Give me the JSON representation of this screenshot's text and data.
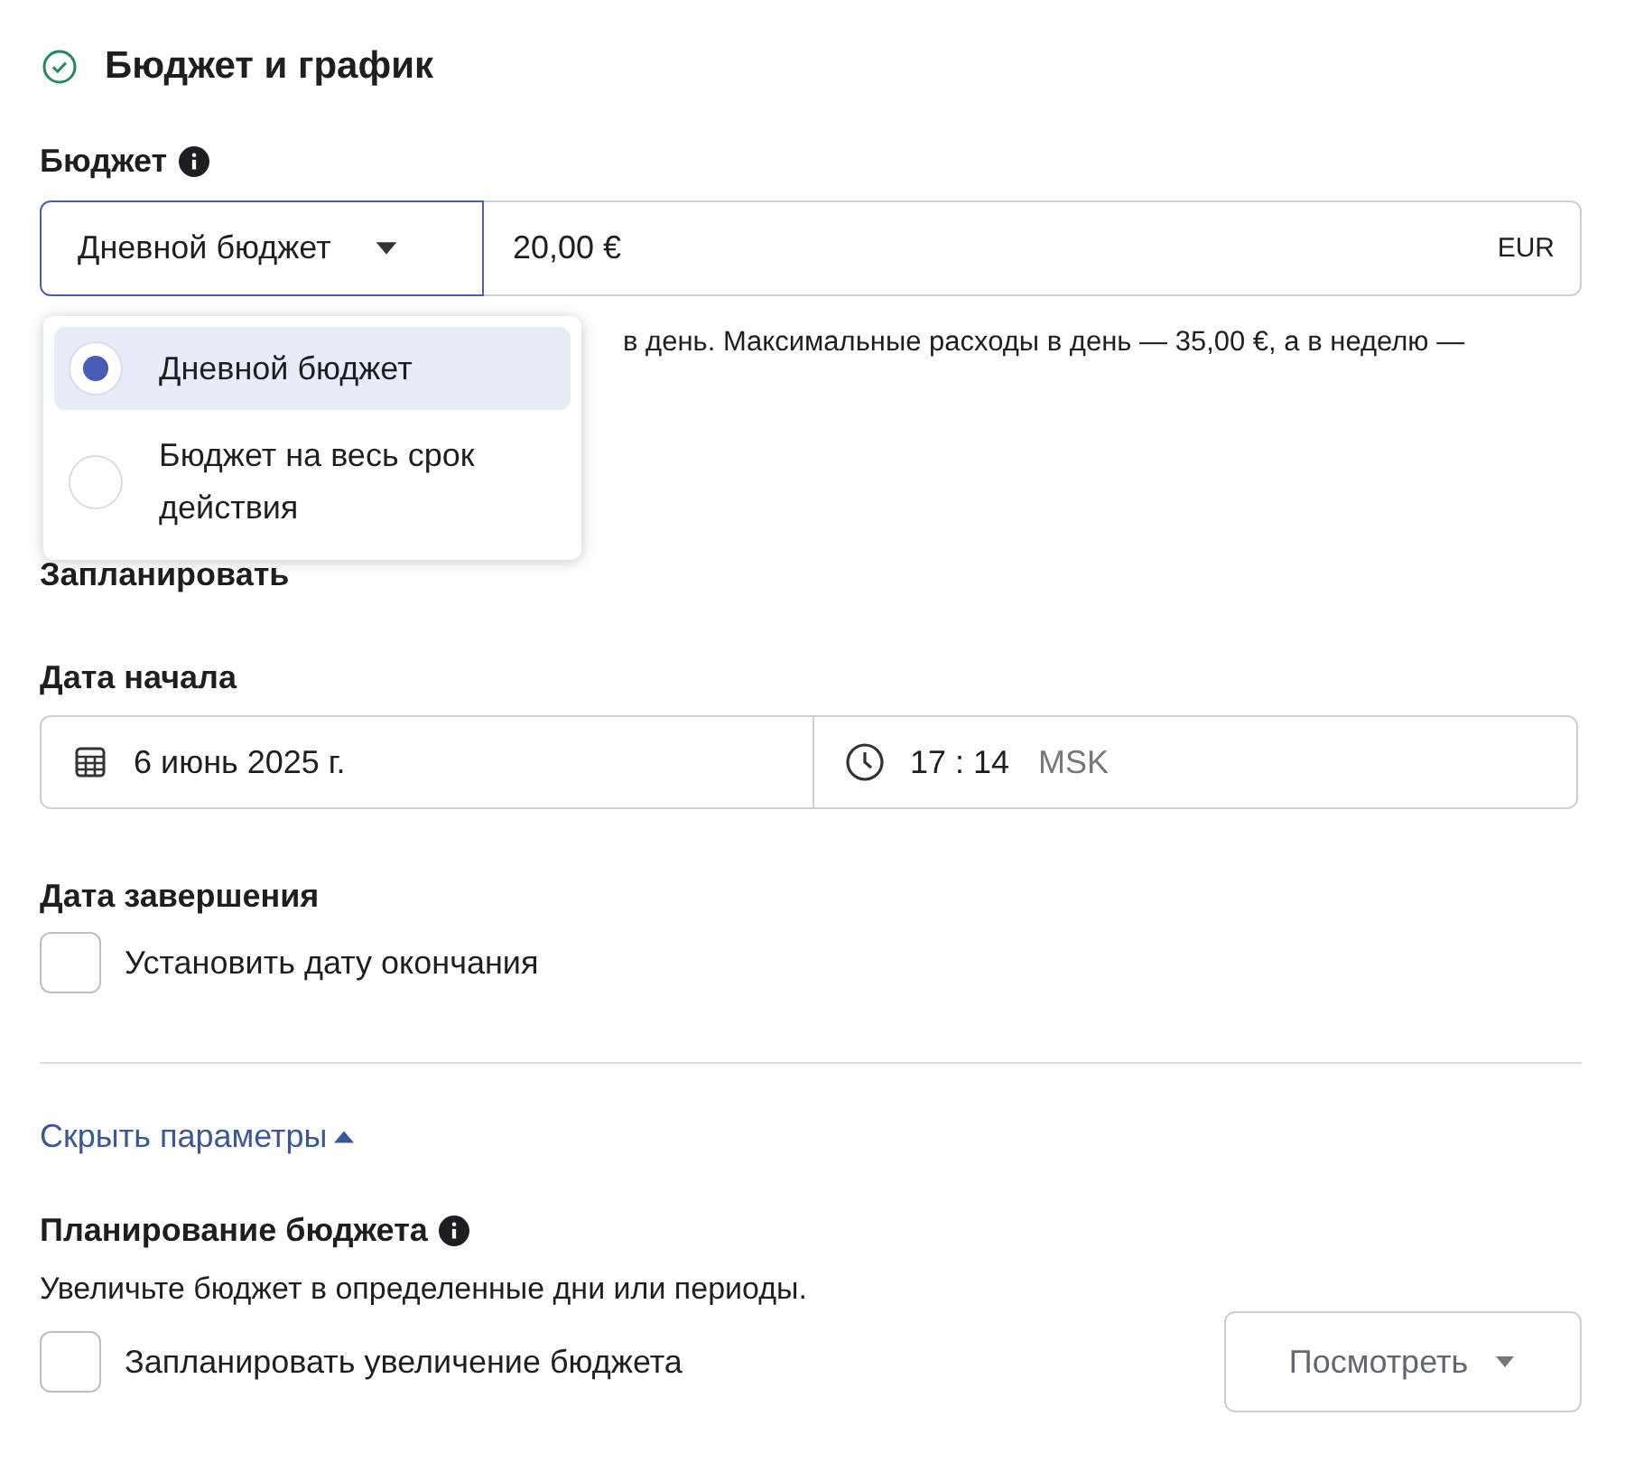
{
  "section": {
    "title": "Бюджет и график",
    "completed": true
  },
  "budget": {
    "label": "Бюджет",
    "type_select": {
      "value": "Дневной бюджет",
      "expanded": true
    },
    "amount": "20,00 €",
    "currency": "EUR",
    "hint": "в день. Максимальные расходы в день — 35,00 €, а в неделю —",
    "options": [
      {
        "label": "Дневной бюджет",
        "selected": true
      },
      {
        "label": "Бюджет на весь срок действия",
        "selected": false
      }
    ]
  },
  "schedule_label": "Запланировать",
  "start_date": {
    "label": "Дата начала",
    "date": "6 июнь 2025 г.",
    "time": "17 : 14",
    "timezone": "MSK"
  },
  "end_date": {
    "label": "Дата завершения",
    "checkbox": {
      "label": "Установить дату окончания",
      "checked": false
    }
  },
  "toggle_link": {
    "label": "Скрыть параметры",
    "expanded": true
  },
  "budget_planning": {
    "label": "Планирование бюджета",
    "description": "Увеличьте бюджет в определенные дни или периоды.",
    "checkbox": {
      "label": "Запланировать увеличение бюджета",
      "checked": false
    },
    "button": "Посмотреть"
  }
}
